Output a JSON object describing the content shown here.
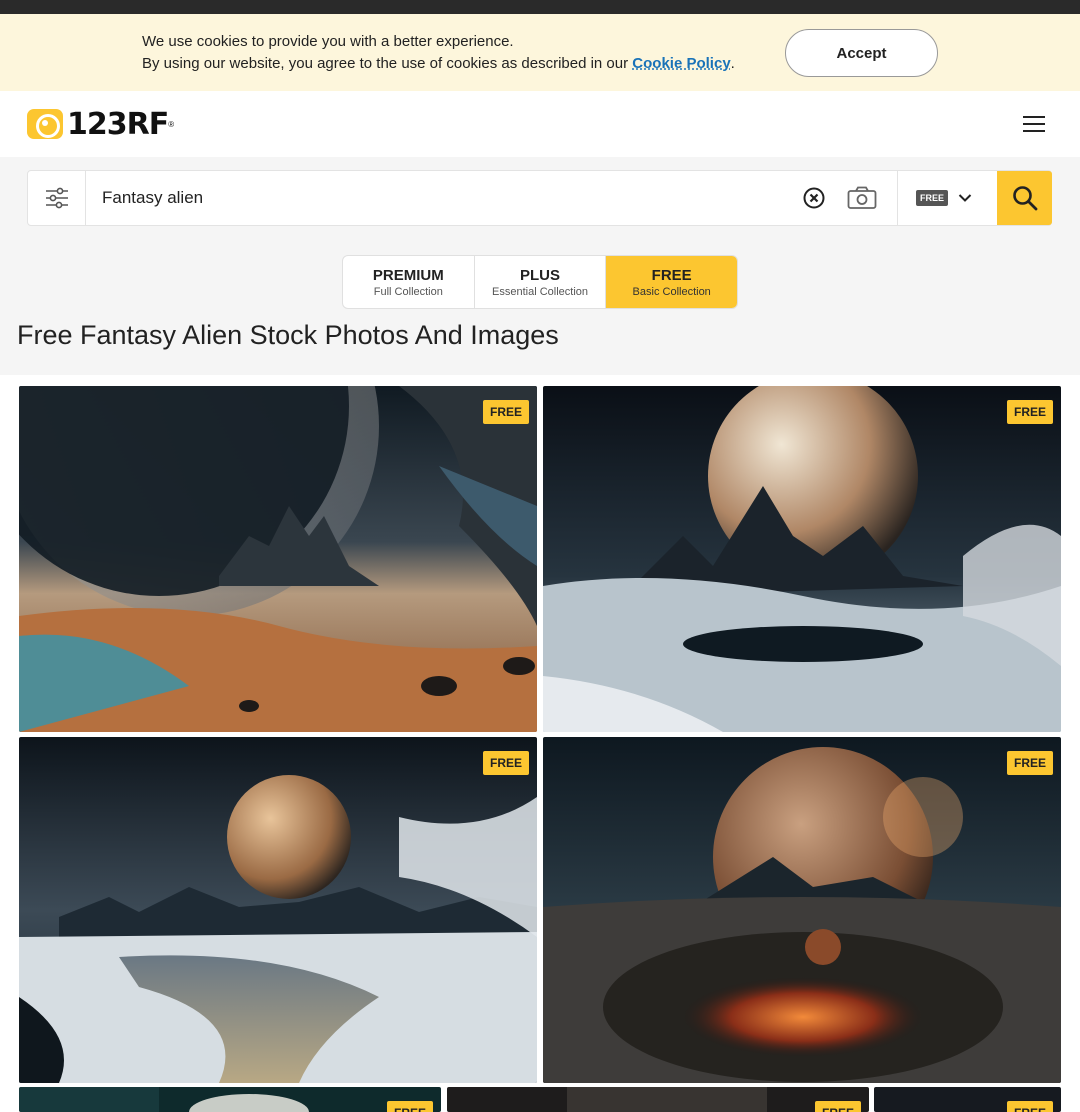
{
  "cookie": {
    "line1": "We use cookies to provide you with a better experience.",
    "line2": "By using our website, you agree to the use of cookies as described in our",
    "link": "Cookie Policy",
    "period": ".",
    "accept": "Accept"
  },
  "header": {
    "logo_text": "123RF",
    "logo_reg": "®"
  },
  "search": {
    "query": "Fantasy alien",
    "license": "FREE"
  },
  "tabs": [
    {
      "title": "PREMIUM",
      "sub": "Full Collection"
    },
    {
      "title": "PLUS",
      "sub": "Essential Collection"
    },
    {
      "title": "FREE",
      "sub": "Basic Collection",
      "active": true
    }
  ],
  "page_title": "Free Fantasy Alien Stock Photos And Images",
  "results": [
    {
      "badge": "FREE"
    },
    {
      "badge": "FREE"
    },
    {
      "badge": "FREE"
    },
    {
      "badge": "FREE"
    },
    {
      "badge": "FREE"
    },
    {
      "badge": "FREE"
    },
    {
      "badge": "FREE"
    }
  ],
  "colors": {
    "accent": "#fcc630",
    "cookie_bg": "#fdf6dc",
    "link": "#1a73b8"
  }
}
